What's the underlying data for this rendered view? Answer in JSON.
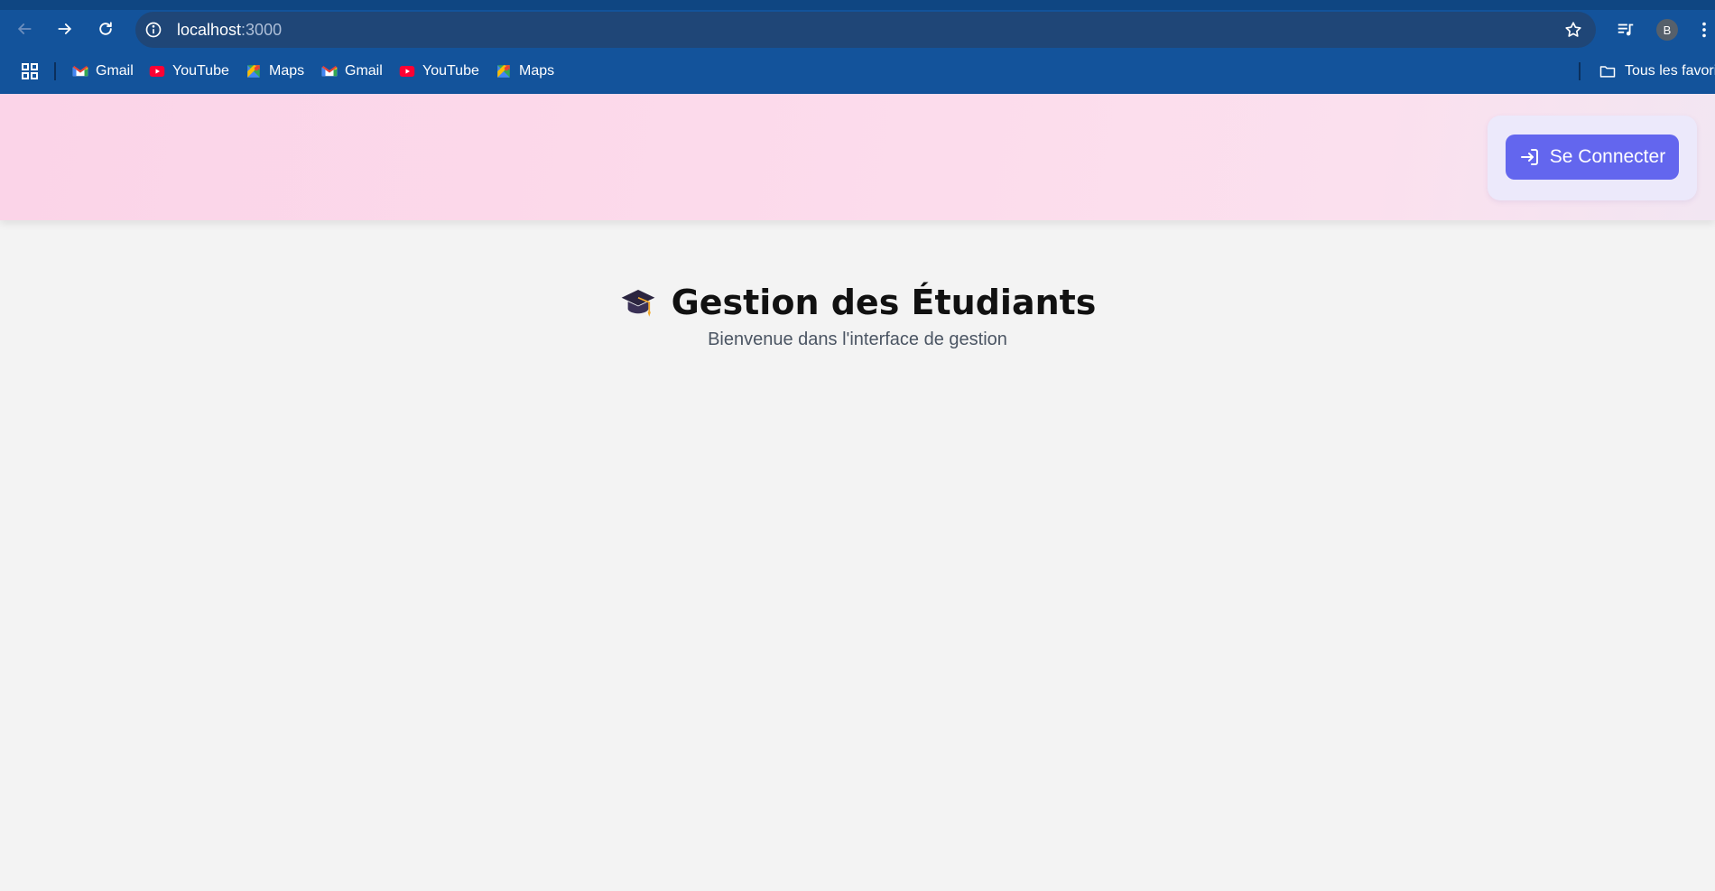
{
  "browser": {
    "url_host": "localhost",
    "url_port": ":3000",
    "profile_initial": "B",
    "bookmarks": [
      {
        "label": "Gmail",
        "icon": "gmail-icon"
      },
      {
        "label": "YouTube",
        "icon": "youtube-icon"
      },
      {
        "label": "Maps",
        "icon": "maps-icon"
      },
      {
        "label": "Gmail",
        "icon": "gmail-icon"
      },
      {
        "label": "YouTube",
        "icon": "youtube-icon"
      },
      {
        "label": "Maps",
        "icon": "maps-icon"
      }
    ],
    "all_bookmarks_label": "Tous les favoris"
  },
  "header": {
    "login_label": "Se Connecter",
    "login_icon": "login-icon",
    "colors": {
      "button": "#6366ee",
      "band": "#fbd4e8"
    }
  },
  "main": {
    "title": "Gestion des Étudiants",
    "title_icon": "graduation-cap-icon",
    "subtitle": "Bienvenue dans l'interface de gestion"
  }
}
